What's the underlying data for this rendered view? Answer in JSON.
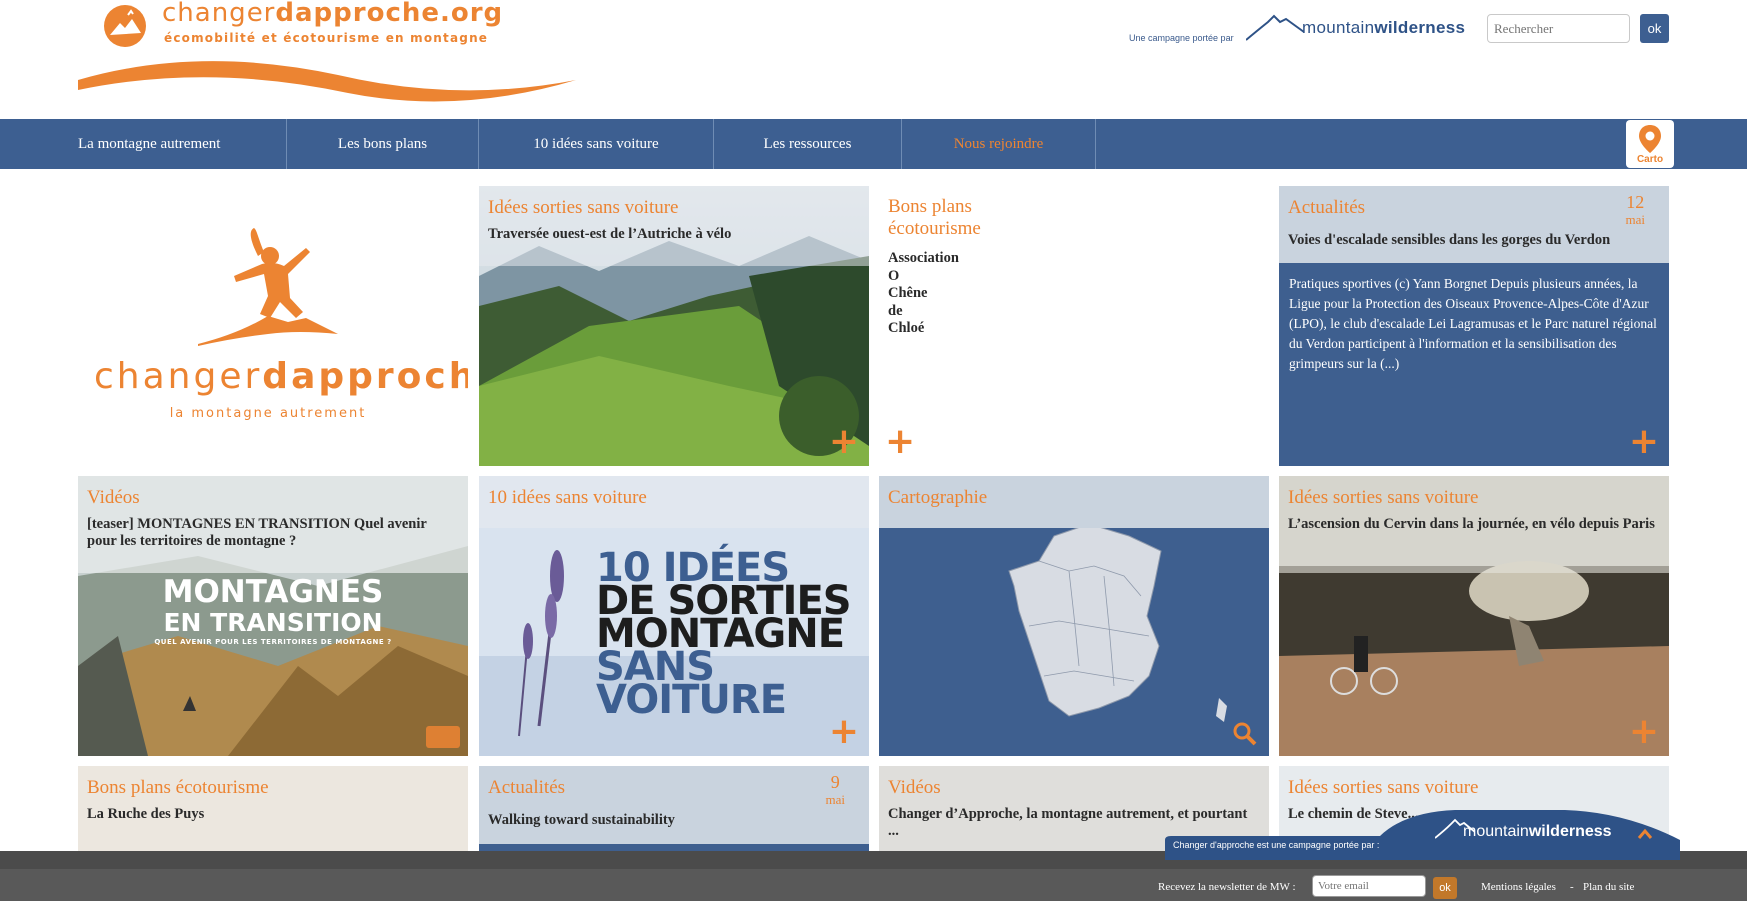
{
  "header": {
    "site_name_light": "changer",
    "site_name_bold": "dapproche",
    "site_name_ext": ".org",
    "site_tagline": "écomobilité et écotourisme en montagne",
    "campaign_label": "Une campagne portée par",
    "mw_name_light": "mountain",
    "mw_name_bold": "wilderness",
    "search_placeholder": "Rechercher",
    "search_button": "ok"
  },
  "nav": {
    "items": [
      {
        "label": "La montagne autrement"
      },
      {
        "label": "Les bons plans"
      },
      {
        "label": "10 idées sans voiture"
      },
      {
        "label": "Les ressources"
      },
      {
        "label": "Nous rejoindre"
      }
    ],
    "carto_label": "Carto"
  },
  "hero_logo": {
    "name_light": "changer",
    "name_bold": "dapproche",
    "tagline": "la montagne autrement"
  },
  "tiles": [
    {
      "category": "Idées sorties sans voiture",
      "title": "Traversée ouest-est de l’Autriche à vélo"
    },
    {
      "category": "Bons plans écotourisme",
      "title_lines": [
        "Association",
        "O",
        "Chêne",
        "de",
        "Chloé"
      ]
    },
    {
      "category": "Actualités",
      "day": "12",
      "month": "mai",
      "title": "Voies d'escalade sensibles dans les gorges du Verdon",
      "excerpt": "Pratiques sportives (c) Yann Borgnet Depuis plusieurs années, la Ligue pour la Protection des Oiseaux Provence-Alpes-Côte d'Azur (LPO), le club d'escalade Lei Lagramusas et le Parc naturel régional du Verdon participent à l'information et la sensibilisation des grimpeurs sur la (...)"
    },
    {
      "category": "Vidéos",
      "title": "[teaser] MONTAGNES EN TRANSITION Quel avenir pour les territoires de montagne ?",
      "image_title_1": "MONTAGNES",
      "image_title_2": "EN TRANSITION",
      "image_subtitle": "QUEL AVENIR POUR LES TERRITOIRES DE MONTAGNE ?"
    },
    {
      "category": "10 idées sans voiture",
      "poster_lines": [
        "10 IDÉES",
        "DE SORTIES",
        "MONTAGNE",
        "SANS",
        "VOITURE"
      ]
    },
    {
      "category": "Cartographie"
    },
    {
      "category": "Idées sorties sans voiture",
      "title": "L’ascension du Cervin dans la journée, en vélo depuis Paris"
    },
    {
      "category": "Bons plans écotourisme",
      "title": "La Ruche des Puys"
    },
    {
      "category": "Actualités",
      "day": "9",
      "month": "mai",
      "title": "Walking toward sustainability"
    },
    {
      "category": "Vidéos",
      "title": "Changer d’Approche, la montagne autrement, et pourtant ..."
    },
    {
      "category": "Idées sorties sans voiture",
      "title": "Le chemin de Steve..."
    }
  ],
  "plus_symbol": "+",
  "mw_banner": {
    "caption": "Changer d'approche est une campagne portée par :",
    "name_light": "mountain",
    "name_bold": "wilderness"
  },
  "footer": {
    "newsletter_label": "Recevez la newsletter de MW :",
    "newsletter_placeholder": "Votre email",
    "newsletter_button": "ok",
    "link_legal": "Mentions légales",
    "separator": "-",
    "link_sitemap": "Plan du site"
  },
  "colors": {
    "accent_orange": "#ec8432",
    "nav_blue": "#3d5f91",
    "tile_blue": "#3e5f8f",
    "tile_grey": "#c9d3de"
  }
}
